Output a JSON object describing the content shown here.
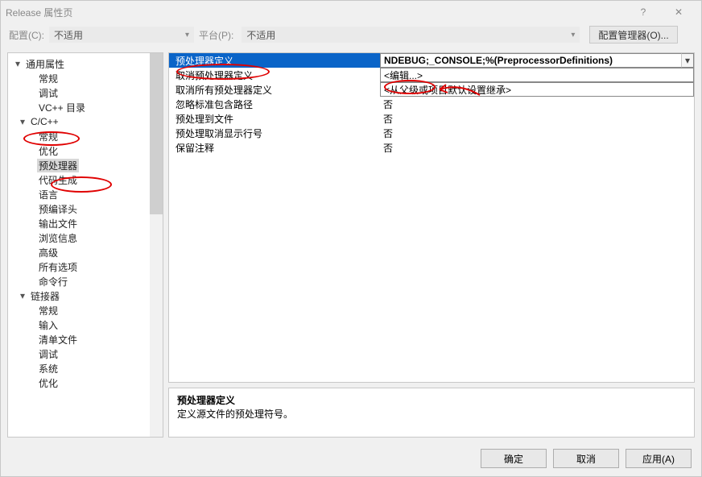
{
  "title": "Release 属性页",
  "toolbar": {
    "config_label": "配置(C):",
    "config_value": "不适用",
    "platform_label": "平台(P):",
    "platform_value": "不适用",
    "cfgmgr": "配置管理器(O)..."
  },
  "tree": [
    {
      "d": 0,
      "a": "▾",
      "t": "通用属性"
    },
    {
      "d": 2,
      "t": "常规"
    },
    {
      "d": 2,
      "t": "调试"
    },
    {
      "d": 2,
      "t": "VC++ 目录"
    },
    {
      "d": 1,
      "a": "▾",
      "t": "C/C++"
    },
    {
      "d": 2,
      "t": "常规"
    },
    {
      "d": 2,
      "t": "优化"
    },
    {
      "d": 2,
      "t": "预处理器",
      "sel": true
    },
    {
      "d": 2,
      "t": "代码生成"
    },
    {
      "d": 2,
      "t": "语言"
    },
    {
      "d": 2,
      "t": "预编译头"
    },
    {
      "d": 2,
      "t": "输出文件"
    },
    {
      "d": 2,
      "t": "浏览信息"
    },
    {
      "d": 2,
      "t": "高级"
    },
    {
      "d": 2,
      "t": "所有选项"
    },
    {
      "d": 2,
      "t": "命令行"
    },
    {
      "d": 1,
      "a": "▾",
      "t": "链接器"
    },
    {
      "d": 2,
      "t": "常规"
    },
    {
      "d": 2,
      "t": "输入"
    },
    {
      "d": 2,
      "t": "清单文件"
    },
    {
      "d": 2,
      "t": "调试"
    },
    {
      "d": 2,
      "t": "系统"
    },
    {
      "d": 2,
      "t": "优化"
    }
  ],
  "grid": [
    {
      "l": "预处理器定义",
      "r": "NDEBUG;_CONSOLE;%(PreprocessorDefinitions)",
      "hl": true,
      "dd": true
    },
    {
      "l": "取消预处理器定义",
      "r": "<编辑...>",
      "box": true
    },
    {
      "l": "取消所有预处理器定义",
      "r": "<从父级或项目默认设置继承>",
      "box": true
    },
    {
      "l": "忽略标准包含路径",
      "r": "否"
    },
    {
      "l": "预处理到文件",
      "r": "否"
    },
    {
      "l": "预处理取消显示行号",
      "r": "否"
    },
    {
      "l": "保留注释",
      "r": "否"
    }
  ],
  "desc": {
    "h": "预处理器定义",
    "b": "定义源文件的预处理符号。"
  },
  "buttons": {
    "ok": "确定",
    "cancel": "取消",
    "apply": "应用(A)"
  },
  "chev": "▾",
  "help": "?",
  "close": "✕"
}
